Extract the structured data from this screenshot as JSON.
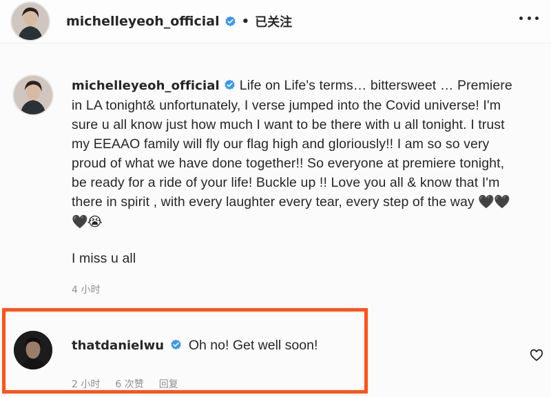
{
  "header": {
    "username": "michelleyeoh_official",
    "separator": "•",
    "follow_status": "已关注"
  },
  "caption": {
    "username": "michelleyeoh_official",
    "text": "Life on Life's terms… bittersweet … Premiere in LA tonight& unfortunately, I verse jumped into the Covid universe! I'm sure u all know just how much I want to be there with u all tonight. I trust my EEAAO family will fly our flag high and gloriously!! I am so so very proud of what we have done together!! So everyone at premiere tonight, be ready for a ride of your life! Buckle up !! Love you all & know that I'm there in spirit , with every laughter every tear, every step of the way ",
    "emoji": "🖤🖤🖤😭",
    "second_line": "I miss u all",
    "time": "4 小时"
  },
  "comment": {
    "username": "thatdanielwu",
    "text": "Oh no! Get well soon!",
    "time": "2 小时",
    "likes": "6 次赞",
    "reply": "回复"
  },
  "colors": {
    "highlight_border": "#ff5319",
    "verified_badge": "#3897f0",
    "meta_text": "#8e8e8e"
  },
  "icons": {
    "more": "more-options-icon",
    "verified": "verified-badge-icon",
    "like": "heart-outline-icon"
  }
}
